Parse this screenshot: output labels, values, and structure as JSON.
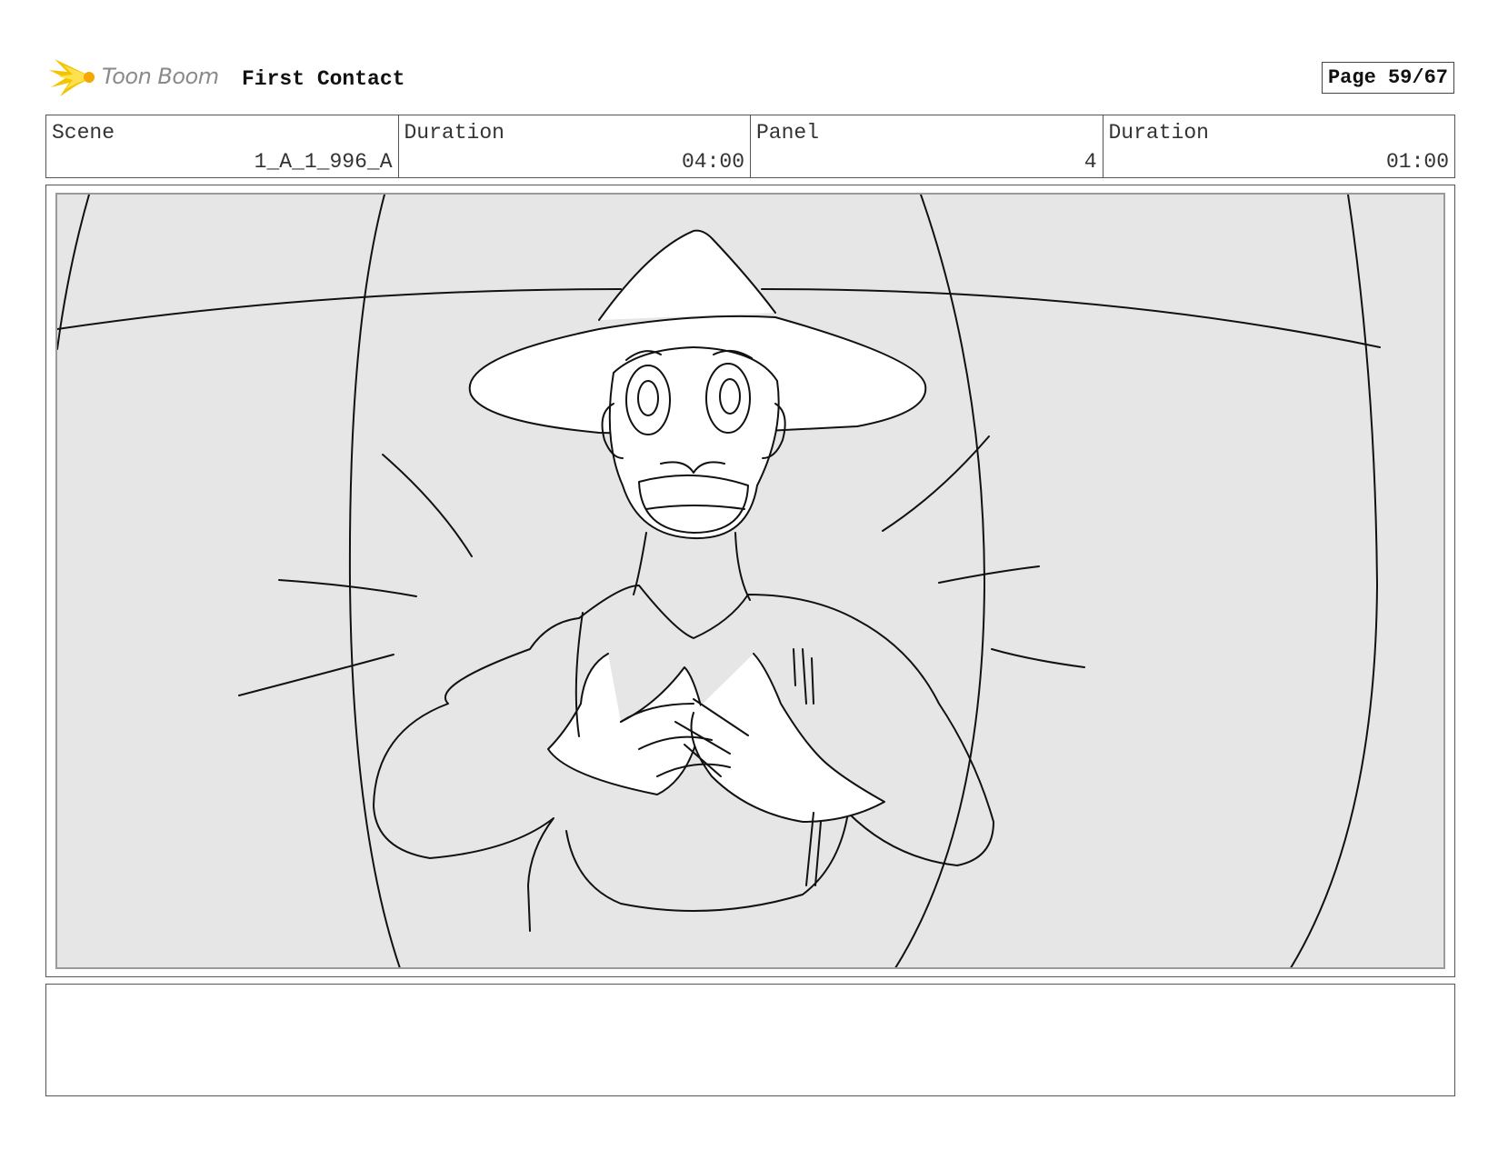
{
  "header": {
    "logo_text": "Toon Boom",
    "project_title": "First Contact",
    "page_label": "Page 59/67"
  },
  "info": {
    "scene_label": "Scene",
    "scene_value": "1_A_1_996_A",
    "scene_duration_label": "Duration",
    "scene_duration_value": "04:00",
    "panel_label": "Panel",
    "panel_value": "4",
    "panel_duration_label": "Duration",
    "panel_duration_value": "01:00"
  },
  "panel_image": {
    "icon": "storyboard-sketch-figure-in-hat-hands-on-chest"
  },
  "notes": {
    "text": ""
  },
  "colors": {
    "logo_yellow": "#f5c400",
    "panel_bg": "#e6e6e6",
    "border": "#555555"
  }
}
